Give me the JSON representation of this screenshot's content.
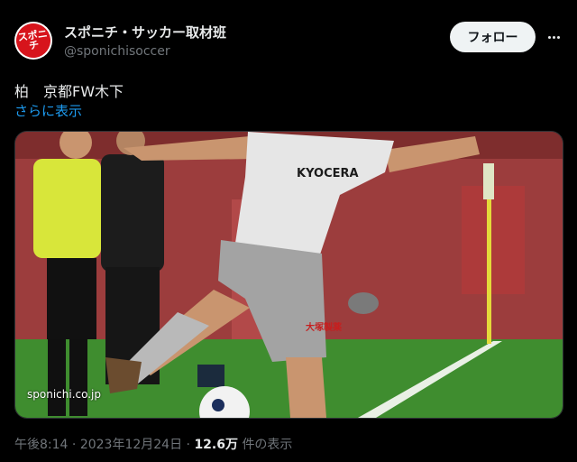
{
  "account": {
    "avatar_text": "スポニチ",
    "display_name": "スポニチ・サッカー取材班",
    "handle": "@sponichisoccer",
    "follow_label": "フォロー"
  },
  "post": {
    "text": "柏　京都FW木下",
    "show_more": "さらに表示",
    "watermark": "sponichi.co.jp",
    "time": "午後8:14",
    "date": "2023年12月24日",
    "views_count": "12.6万",
    "views_label": "件の表示"
  },
  "photo": {
    "jersey_sponsor": "KYOCERA",
    "shorts_sponsor": "大塚製薬",
    "colors": {
      "field": "#3f8d2f",
      "wall": "#9c3d3d",
      "kit": "#e6e6e6",
      "referee": "#d8e63a"
    }
  }
}
